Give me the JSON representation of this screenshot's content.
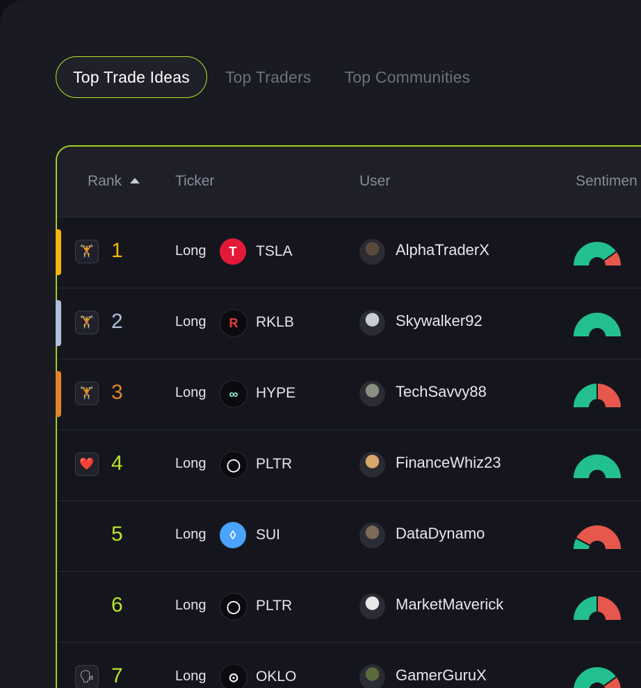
{
  "tabs": [
    {
      "label": "Top Trade Ideas",
      "active": true
    },
    {
      "label": "Top Traders",
      "active": false
    },
    {
      "label": "Top Communities",
      "active": false
    }
  ],
  "table": {
    "headers": {
      "rank": "Rank",
      "ticker": "Ticker",
      "user": "User",
      "sentiment": "Sentimen"
    },
    "rows": [
      {
        "rank": "1",
        "rank_color": "#f2b40d",
        "stripe": "#f2b40d",
        "badge": "🏋",
        "direction": "Long",
        "ticker": "TSLA",
        "ticker_icon": "tesla-logo",
        "user": "AlphaTraderX",
        "sentiment_bull": 0.8
      },
      {
        "rank": "2",
        "rank_color": "#aebfdc",
        "stripe": "#aebfdc",
        "badge": "🏋",
        "direction": "Long",
        "ticker": "RKLB",
        "ticker_icon": "rocketlab-logo",
        "user": "Skywalker92",
        "sentiment_bull": 1.0
      },
      {
        "rank": "3",
        "rank_color": "#e2842b",
        "stripe": "#e2842b",
        "badge": "🏋",
        "direction": "Long",
        "ticker": "HYPE",
        "ticker_icon": "hyperliquid-logo",
        "user": "TechSavvy88",
        "sentiment_bull": 0.5
      },
      {
        "rank": "4",
        "rank_color": "#b8e62a",
        "stripe": "",
        "badge": "❤️",
        "direction": "Long",
        "ticker": "PLTR",
        "ticker_icon": "palantir-logo",
        "user": "FinanceWhiz23",
        "sentiment_bull": 1.0
      },
      {
        "rank": "5",
        "rank_color": "#b8e62a",
        "stripe": "",
        "badge": "",
        "direction": "Long",
        "ticker": "SUI",
        "ticker_icon": "sui-logo",
        "user": "DataDynamo",
        "sentiment_bull": 0.15
      },
      {
        "rank": "6",
        "rank_color": "#b8e62a",
        "stripe": "",
        "badge": "",
        "direction": "Long",
        "ticker": "PLTR",
        "ticker_icon": "palantir-logo",
        "user": "MarketMaverick",
        "sentiment_bull": 0.5
      },
      {
        "rank": "7",
        "rank_color": "#b8e62a",
        "stripe": "",
        "badge": "🗣",
        "direction": "Long",
        "ticker": "OKLO",
        "ticker_icon": "oklo-logo",
        "user": "GamerGuruX",
        "sentiment_bull": 0.8
      }
    ]
  },
  "colors": {
    "accent": "#b8e62a",
    "bull": "#22c08f",
    "bear": "#e6584c"
  }
}
